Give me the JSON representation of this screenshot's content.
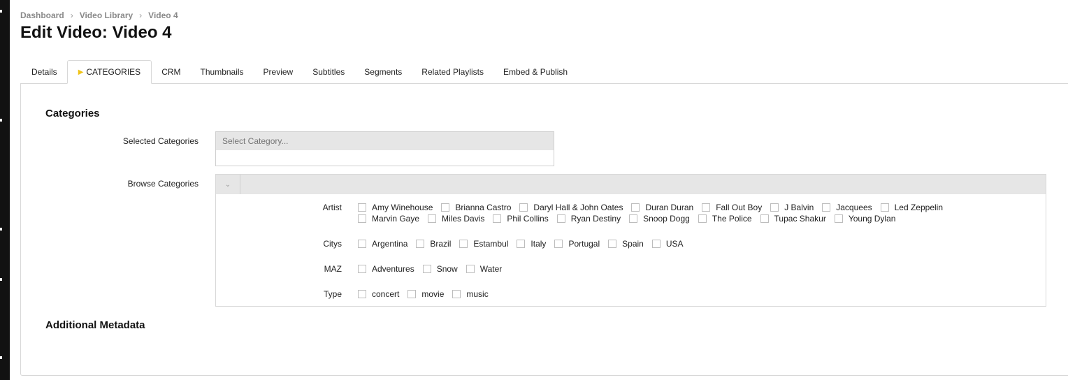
{
  "breadcrumb": [
    "Dashboard",
    "Video Library",
    "Video 4"
  ],
  "page_title": "Edit Video: Video 4",
  "tabs": [
    {
      "label": "Details",
      "active": false
    },
    {
      "label": "CATEGORIES",
      "active": true
    },
    {
      "label": "CRM",
      "active": false
    },
    {
      "label": "Thumbnails",
      "active": false
    },
    {
      "label": "Preview",
      "active": false
    },
    {
      "label": "Subtitles",
      "active": false
    },
    {
      "label": "Segments",
      "active": false
    },
    {
      "label": "Related Playlists",
      "active": false
    },
    {
      "label": "Embed & Publish",
      "active": false
    }
  ],
  "categories_section": {
    "title": "Categories",
    "selected_label": "Selected Categories",
    "select_placeholder": "Select Category...",
    "browse_label": "Browse Categories",
    "browse_toggle_icon": "chevron-down-icon",
    "groups": [
      {
        "name": "Artist",
        "options": [
          "Amy Winehouse",
          "Brianna Castro",
          "Daryl Hall & John Oates",
          "Duran Duran",
          "Fall Out Boy",
          "J Balvin",
          "Jacquees",
          "Led Zeppelin",
          "Marvin Gaye",
          "Miles Davis",
          "Phil Collins",
          "Ryan Destiny",
          "Snoop Dogg",
          "The Police",
          "Tupac Shakur",
          "Young Dylan"
        ]
      },
      {
        "name": "Citys",
        "options": [
          "Argentina",
          "Brazil",
          "Estambul",
          "Italy",
          "Portugal",
          "Spain",
          "USA"
        ]
      },
      {
        "name": "MAZ",
        "options": [
          "Adventures",
          "Snow",
          "Water"
        ]
      },
      {
        "name": "Type",
        "options": [
          "concert",
          "movie",
          "music"
        ]
      }
    ]
  },
  "additional_section": {
    "title": "Additional Metadata"
  },
  "colors": {
    "active_tab_marker": "#f0c419",
    "header_bg": "#e6e6e6",
    "border": "#d8d8d8"
  }
}
